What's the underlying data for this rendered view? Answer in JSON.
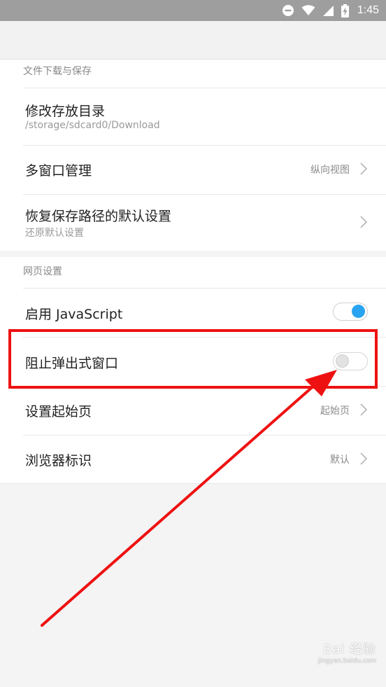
{
  "status_bar": {
    "time": "1:45",
    "icons": [
      "do-not-disturb-icon",
      "wifi-icon",
      "signal-icon",
      "battery-charging-icon"
    ]
  },
  "sections": {
    "download": {
      "header": "文件下载与保存"
    },
    "web": {
      "header": "网页设置"
    }
  },
  "items": {
    "storage_dir": {
      "title": "修改存放目录",
      "subtitle": "/storage/sdcard0/Download"
    },
    "multi_window": {
      "title": "多窗口管理",
      "value": "纵向视图"
    },
    "restore_path": {
      "title": "恢复保存路径的默认设置",
      "subtitle": "还原默认设置"
    },
    "javascript": {
      "title": "启用 JavaScript",
      "enabled": true
    },
    "block_popups": {
      "title": "阻止弹出式窗口",
      "enabled": false
    },
    "start_page": {
      "title": "设置起始页",
      "value": "起始页"
    },
    "user_agent": {
      "title": "浏览器标识",
      "value": "默认"
    }
  },
  "colors": {
    "status_bar": "#9e9e9e",
    "toggle_on": "#2aa3f0",
    "annotation_red": "#ee1111"
  },
  "watermark": {
    "mark": "Bai 经验",
    "url": "jingyan.baidu.com"
  }
}
